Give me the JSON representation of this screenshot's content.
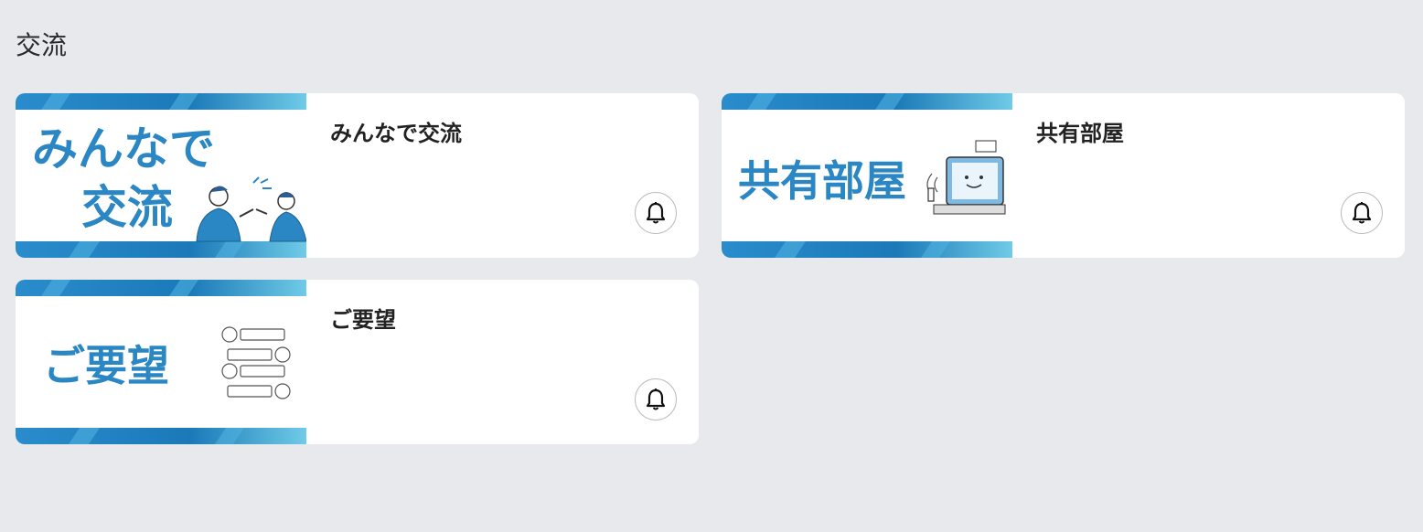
{
  "section": {
    "title": "交流"
  },
  "cards": [
    {
      "title": "みんなで交流",
      "thumb_lines": [
        "みんなで",
        "交流"
      ],
      "notify_icon": "bell-icon"
    },
    {
      "title": "共有部屋",
      "thumb_lines": [
        "共有部屋"
      ],
      "notify_icon": "bell-icon"
    },
    {
      "title": "ご要望",
      "thumb_lines": [
        "ご要望"
      ],
      "notify_icon": "bell-icon"
    }
  ],
  "colors": {
    "background": "#e8e9ed",
    "card": "#ffffff",
    "brand_blue": "#2a87c4",
    "stripe_light": "#5fc3e6",
    "stripe_dark": "#1a6fae"
  }
}
